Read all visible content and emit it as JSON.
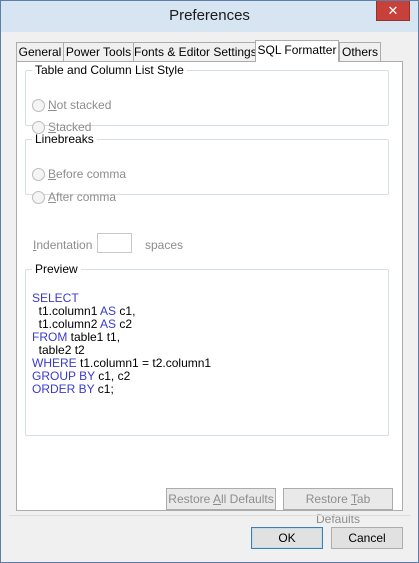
{
  "window": {
    "title": "Preferences",
    "close_glyph": "✕"
  },
  "tabs": [
    {
      "label": "General",
      "active": false
    },
    {
      "label": "Power Tools",
      "active": false
    },
    {
      "label": "Fonts & Editor Settings",
      "active": false
    },
    {
      "label": "SQL Formatter",
      "active": true
    },
    {
      "label": "Others",
      "active": false
    }
  ],
  "table_style": {
    "legend": "Table and Column List Style",
    "options": [
      {
        "label_u": "N",
        "label_rest": "ot stacked",
        "selected": false,
        "enabled": false
      },
      {
        "label_u": "S",
        "label_rest": "tacked",
        "selected": false,
        "enabled": false
      }
    ]
  },
  "linebreaks": {
    "legend": "Linebreaks",
    "options": [
      {
        "label_u": "B",
        "label_rest": "efore comma",
        "selected": false,
        "enabled": false
      },
      {
        "label_u": "A",
        "label_rest": "fter comma",
        "selected": false,
        "enabled": false
      }
    ]
  },
  "indentation": {
    "label_u": "I",
    "label_rest": "ndentation",
    "value": "",
    "unit": "spaces"
  },
  "preview": {
    "legend": "Preview",
    "keyword_color": "#3a3acf",
    "lines": [
      [
        {
          "t": "SELECT",
          "kw": true
        }
      ],
      [
        {
          "t": "  t1.column1 ",
          "kw": false
        },
        {
          "t": "AS",
          "kw": true
        },
        {
          "t": " c1,",
          "kw": false
        }
      ],
      [
        {
          "t": "  t1.column2 ",
          "kw": false
        },
        {
          "t": "AS",
          "kw": true
        },
        {
          "t": " c2",
          "kw": false
        }
      ],
      [
        {
          "t": "FROM",
          "kw": true
        },
        {
          "t": " table1 t1,",
          "kw": false
        }
      ],
      [
        {
          "t": "  table2 t2",
          "kw": false
        }
      ],
      [
        {
          "t": "WHERE",
          "kw": true
        },
        {
          "t": " t1.column1 = t2.column1",
          "kw": false
        }
      ],
      [
        {
          "t": "GROUP BY",
          "kw": true
        },
        {
          "t": " c1, c2",
          "kw": false
        }
      ],
      [
        {
          "t": "ORDER BY",
          "kw": true
        },
        {
          "t": " c1;",
          "kw": false
        }
      ]
    ]
  },
  "buttons": {
    "restore_all": {
      "pre": "Restore ",
      "u": "A",
      "post": "ll Defaults"
    },
    "restore_tab": {
      "pre": "Restore ",
      "u": "T",
      "post": "ab Defaults"
    },
    "ok": "OK",
    "cancel": "Cancel"
  }
}
